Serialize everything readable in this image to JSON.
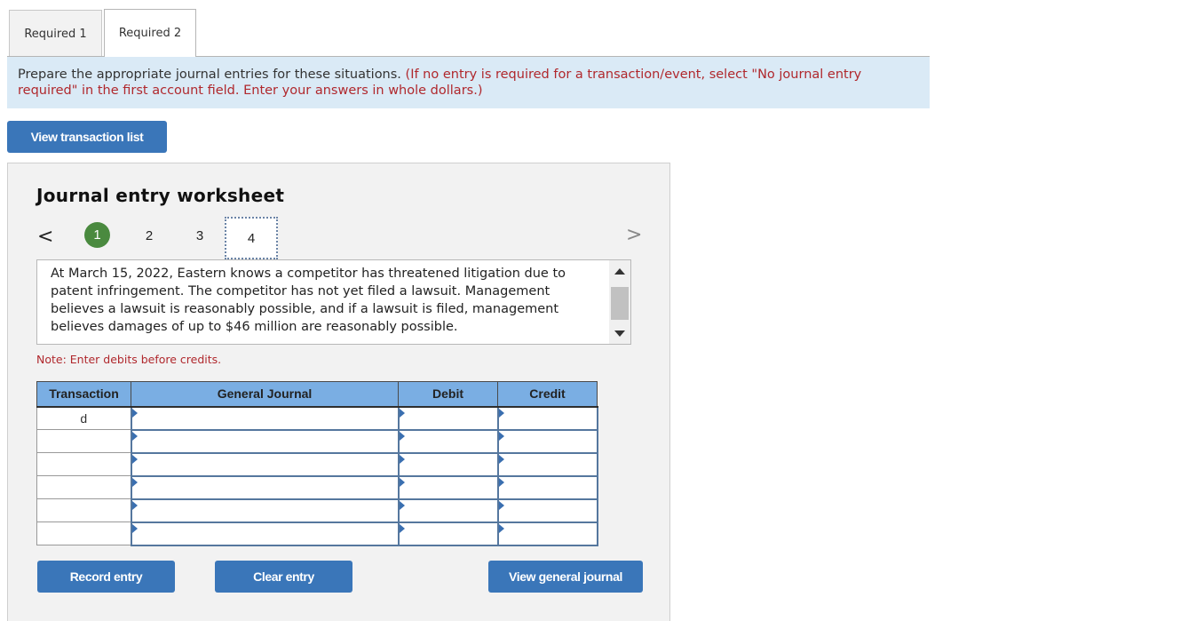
{
  "tabs": [
    {
      "label": "Required 1",
      "active": false
    },
    {
      "label": "Required 2",
      "active": true
    }
  ],
  "instructions": {
    "main": "Prepare the appropriate journal entries for these situations. ",
    "note": "(If no entry is required for a transaction/event, select \"No journal entry required\" in the first account field. Enter your answers in whole dollars.)"
  },
  "buttons": {
    "view_transactions": "View transaction list",
    "record_entry": "Record entry",
    "clear_entry": "Clear entry",
    "view_general_journal": "View general journal"
  },
  "worksheet": {
    "title": "Journal entry worksheet",
    "pager": {
      "prev_icon": "chevron-left-icon",
      "next_icon": "chevron-right-icon",
      "prev_glyph": "<",
      "next_glyph": ">",
      "pages": [
        {
          "label": "1",
          "state": "completed"
        },
        {
          "label": "2",
          "state": "pending"
        },
        {
          "label": "3",
          "state": "pending"
        },
        {
          "label": "4",
          "state": "current"
        }
      ]
    },
    "description": "At March 15, 2022, Eastern knows a competitor has threatened litigation due to patent infringement. The competitor has not yet filed a lawsuit. Management believes a lawsuit is reasonably possible, and if a lawsuit is filed, management believes damages of up to $46 million are reasonably possible.",
    "note": "Note: Enter debits before credits.",
    "table": {
      "headers": [
        "Transaction",
        "General Journal",
        "Debit",
        "Credit"
      ],
      "rows": [
        {
          "transaction": "d",
          "account": "",
          "debit": "",
          "credit": ""
        },
        {
          "transaction": "",
          "account": "",
          "debit": "",
          "credit": ""
        },
        {
          "transaction": "",
          "account": "",
          "debit": "",
          "credit": ""
        },
        {
          "transaction": "",
          "account": "",
          "debit": "",
          "credit": ""
        },
        {
          "transaction": "",
          "account": "",
          "debit": "",
          "credit": ""
        },
        {
          "transaction": "",
          "account": "",
          "debit": "",
          "credit": ""
        }
      ]
    }
  },
  "colors": {
    "button_blue": "#3a76b9",
    "header_blue": "#7aaee3",
    "instruction_bg": "#daeaf6",
    "instruction_red": "#b0282d",
    "completed_green": "#4a8a3f"
  }
}
